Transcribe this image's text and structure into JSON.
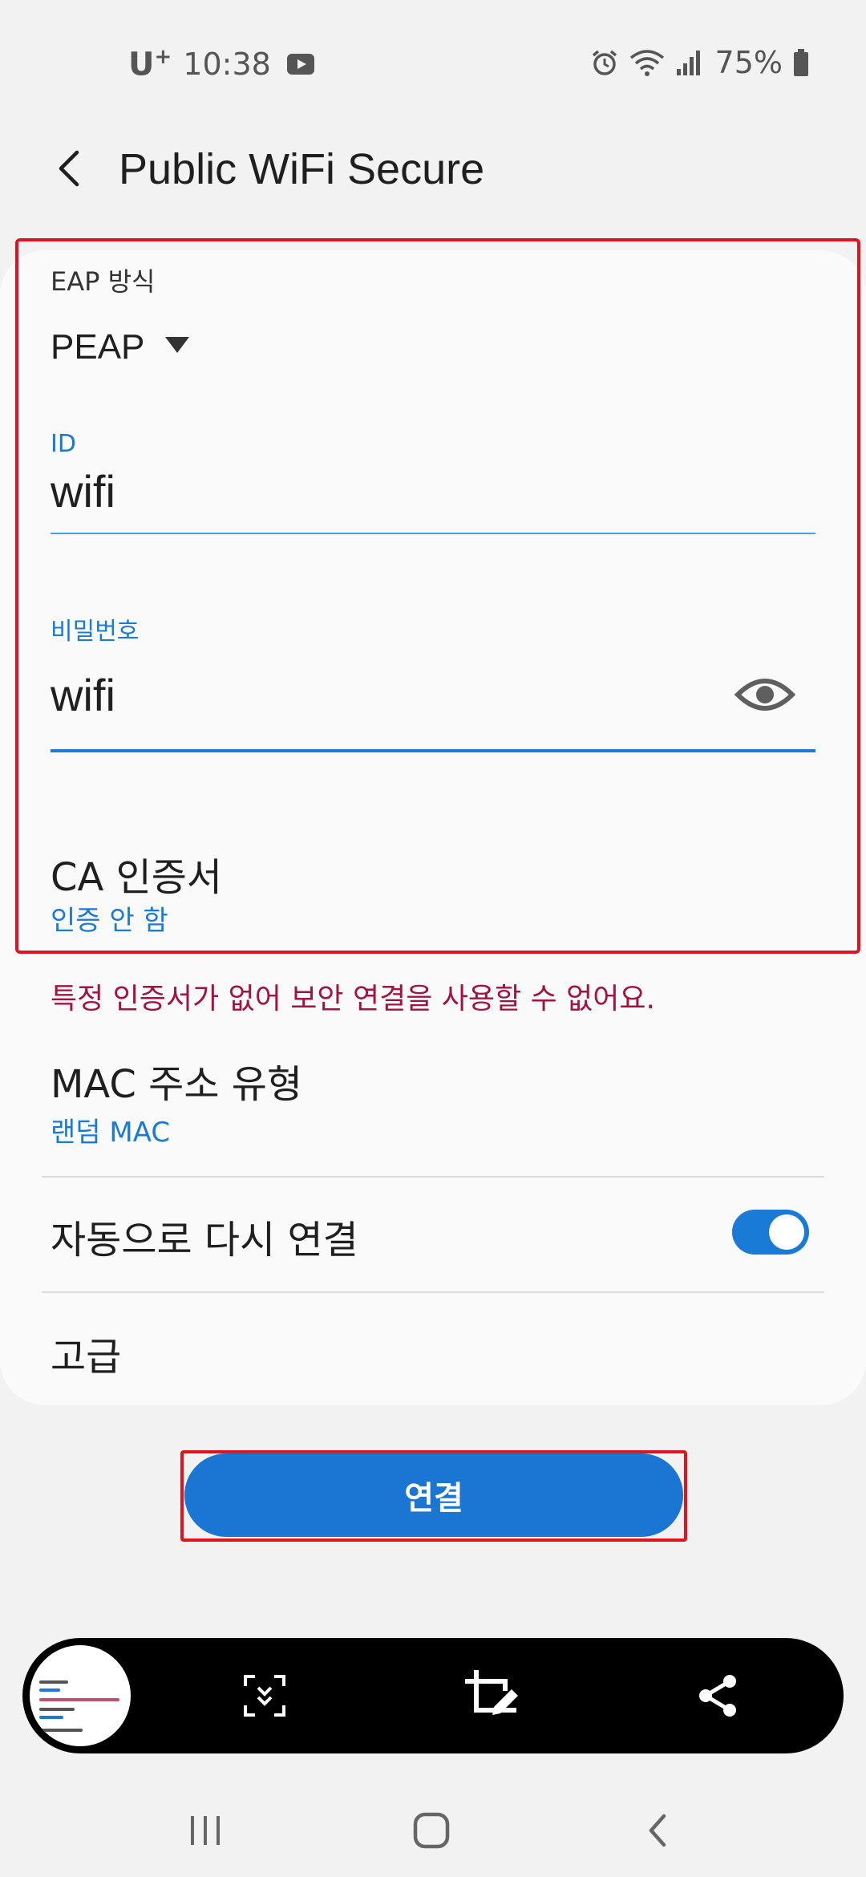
{
  "status_bar": {
    "carrier": "U",
    "carrier_sup": "+",
    "time": "10:38",
    "battery_percent": "75%",
    "icons": [
      "youtube-icon",
      "alarm-icon",
      "wifi-icon",
      "signal-icon",
      "battery-icon"
    ]
  },
  "header": {
    "title": "Public WiFi Secure",
    "back_icon": "back-arrow-icon"
  },
  "form": {
    "eap": {
      "label": "EAP 방식",
      "value": "PEAP"
    },
    "identity": {
      "label": "ID",
      "value": "wifi"
    },
    "password": {
      "label": "비밀번호",
      "value": "wifi",
      "toggle_icon": "eye-icon"
    },
    "ca_cert": {
      "title": "CA 인증서",
      "value": "인증 안 함"
    },
    "warning": "특정 인증서가 없어 보안 연결을 사용할 수 없어요.",
    "mac": {
      "title": "MAC 주소 유형",
      "value": "랜덤 MAC"
    },
    "auto_reconnect": {
      "title": "자동으로 다시 연결",
      "enabled": true
    },
    "advanced": {
      "title": "고급"
    }
  },
  "connect_button": {
    "label": "연결"
  },
  "screenshot_toolbar": {
    "icons": [
      "scroll-capture-icon",
      "crop-edit-icon",
      "share-icon"
    ]
  },
  "nav_bar": {
    "icons": [
      "recents-icon",
      "home-icon",
      "back-icon"
    ]
  },
  "colors": {
    "accent": "#1a7bd6",
    "warning": "#a4123f",
    "highlight": "#e0141e",
    "background": "#f2f2f2",
    "card": "#fafafa"
  }
}
